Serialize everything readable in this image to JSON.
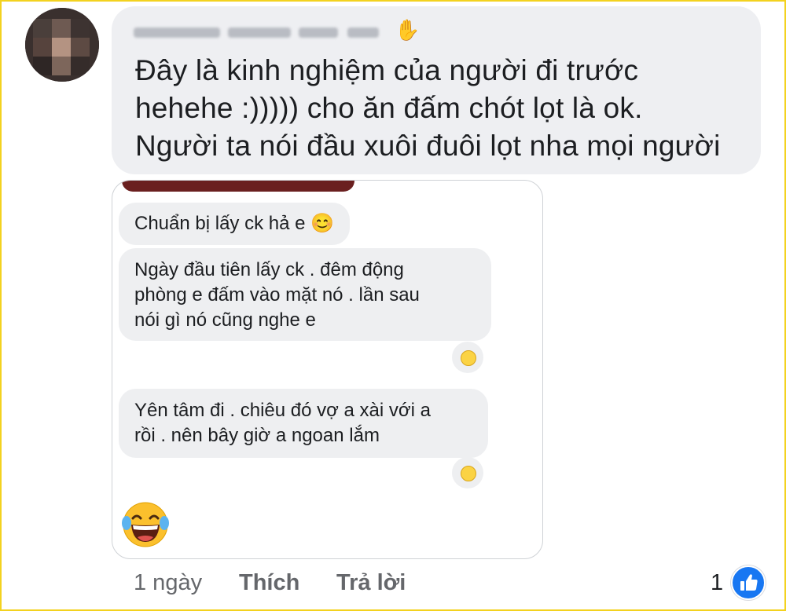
{
  "colors": {
    "frame": "#f3d21f",
    "bubble": "#eeeff2",
    "text": "#1c1e21",
    "meta": "#65676b",
    "like_blue": "#1877f2"
  },
  "comment": {
    "author_name": "",
    "author_icon": "waving-hand-icon",
    "text_lines": [
      "Đây là kinh nghiệm của người đi trước",
      "hehehe :))))) cho ăn đấm chót lọt là ok.",
      "Người ta nói đầu xuôi đuôi lọt nha mọi người"
    ],
    "time": "1 ngày",
    "like_label": "Thích",
    "reply_label": "Trả lời",
    "reaction_count": "1",
    "reaction_icon": "like-thumb-icon"
  },
  "screenshot": {
    "messages": [
      {
        "lines": [
          "Chuẩn bị lấy ck hả e 😊"
        ],
        "reaction": null
      },
      {
        "lines": [
          "Ngày đầu tiên lấy ck . đêm động",
          "phòng e đấm vào mặt nó . lần sau",
          "nói gì nó cũng nghe e"
        ],
        "reaction": "laughing-emoji-icon"
      },
      {
        "lines": [
          "Yên tâm đi . chiêu đó vợ a xài với a",
          "rồi . nên bây giờ a ngoan lắm"
        ],
        "reaction": "laughing-emoji-icon"
      }
    ],
    "sticker": "tears-of-joy-emoji-icon"
  }
}
